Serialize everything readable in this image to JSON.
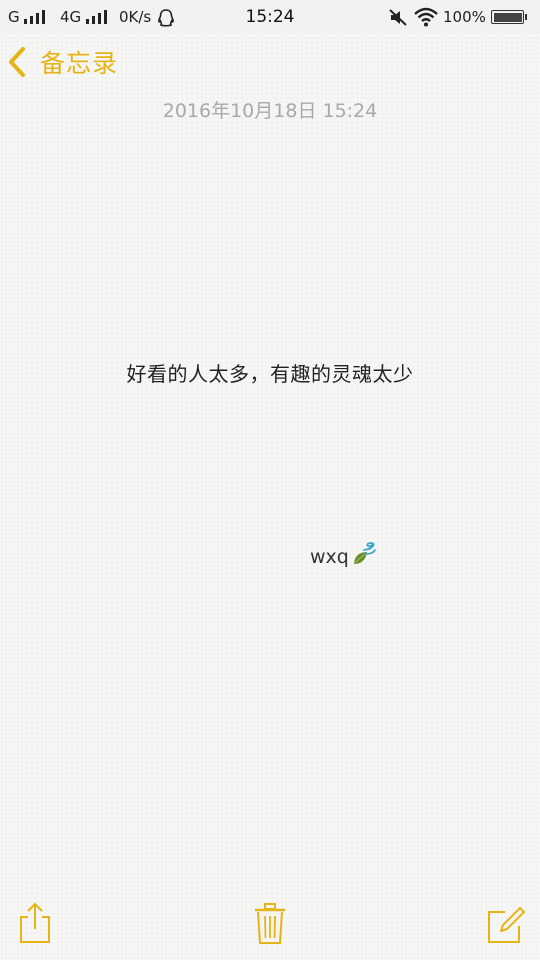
{
  "status_bar": {
    "carrier1": "G",
    "carrier2": "4G",
    "net_speed": "0K/s",
    "time": "15:24",
    "battery": "100%",
    "battery_level": 1.0
  },
  "nav": {
    "back_label": "备忘录"
  },
  "note": {
    "timestamp": "2016年10月18日 15:24",
    "body": "好看的人太多，有趣的灵魂太少",
    "signature": "wxq"
  },
  "toolbar": {
    "share_icon": "share-icon",
    "delete_icon": "trash-icon",
    "compose_icon": "compose-icon"
  },
  "colors": {
    "accent": "#e5b418",
    "background": "#f5f5f3",
    "timestamp": "#a9a9a9"
  }
}
